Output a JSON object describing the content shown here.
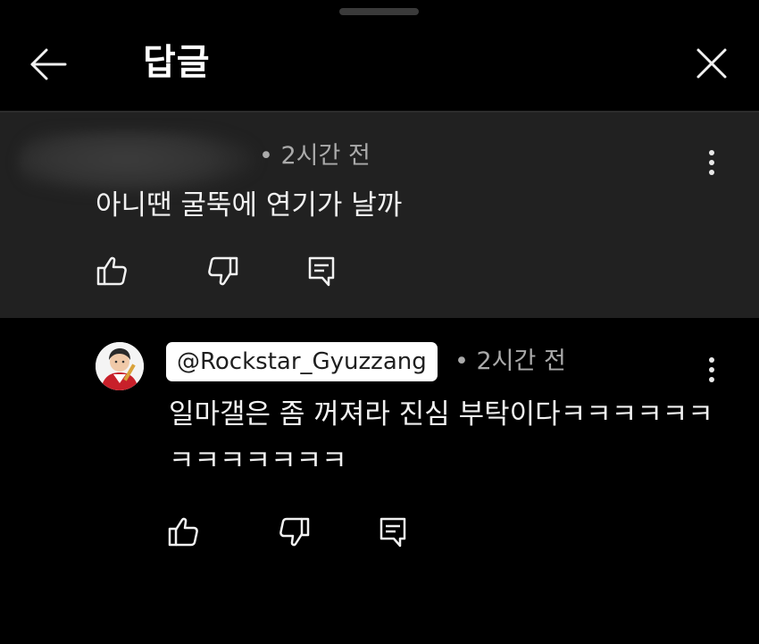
{
  "header": {
    "title": "답글",
    "back_icon": "arrow-left-icon",
    "close_icon": "close-icon"
  },
  "parent_comment": {
    "author": "",
    "time": "• 2시간 전",
    "text": "아니땐 굴뚝에 연기가 날까",
    "actions": [
      "thumb-up-icon",
      "thumb-down-icon",
      "reply-icon"
    ]
  },
  "reply_comment": {
    "author": "@Rockstar_Gyuzzang",
    "time": "• 2시간 전",
    "text": "일마갤은 좀 꺼져라 진심 부탁이다ㅋㅋㅋㅋㅋㅋㅋㅋㅋㅋㅋㅋㅋ",
    "actions": [
      "thumb-up-icon",
      "thumb-down-icon",
      "reply-icon"
    ]
  },
  "colors": {
    "background": "#000000",
    "highlight_background": "#212121",
    "primary_text": "#f1f1f1",
    "secondary_text": "#aaaaaa",
    "chip_background": "#ffffff"
  }
}
